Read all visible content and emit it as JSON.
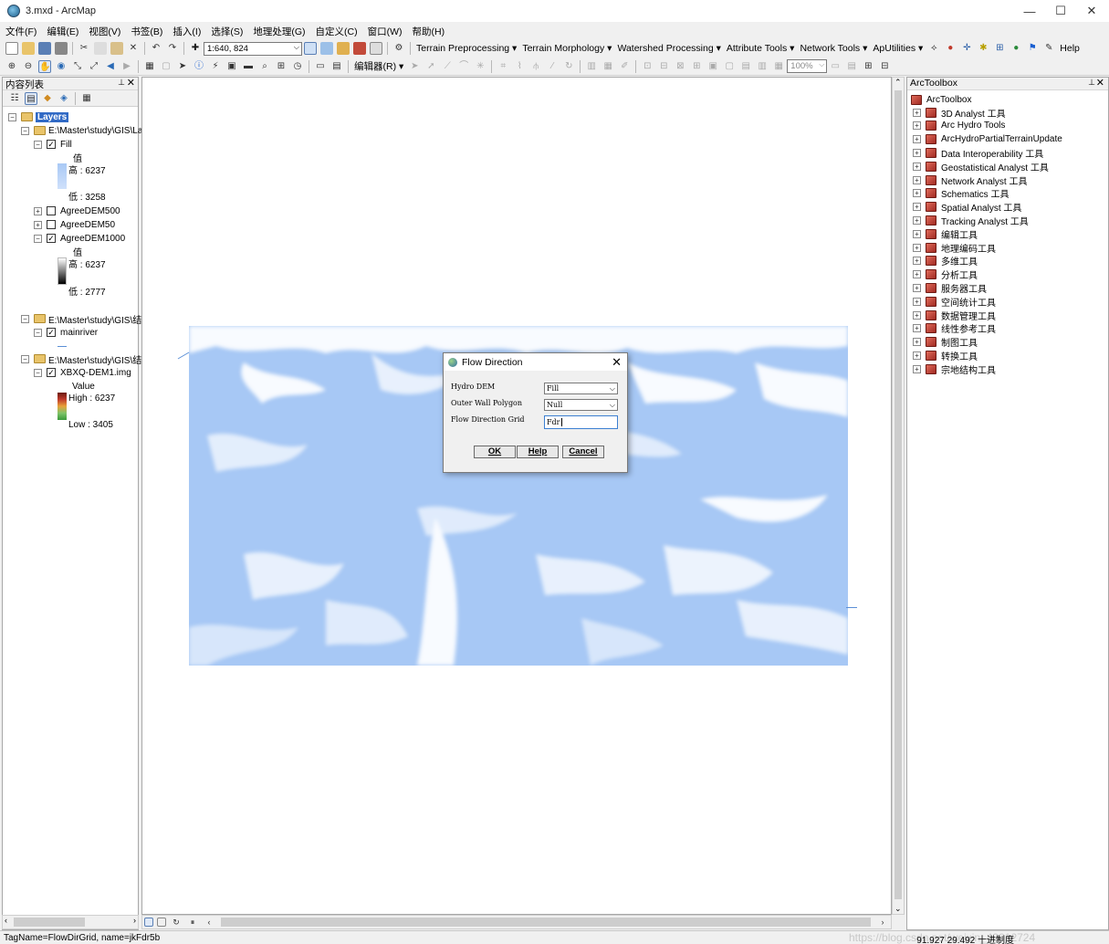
{
  "window": {
    "title": "3.mxd - ArcMap",
    "minimize": "—",
    "maximize": "☐",
    "close": "✕"
  },
  "menu": [
    "文件(F)",
    "编辑(E)",
    "视图(V)",
    "书签(B)",
    "插入(I)",
    "选择(S)",
    "地理处理(G)",
    "自定义(C)",
    "窗口(W)",
    "帮助(H)"
  ],
  "toolbar": {
    "scale": "1:640, 824",
    "menus": [
      "Terrain Preprocessing",
      "Terrain Morphology",
      "Watershed Processing",
      "Attribute Tools",
      "Network Tools",
      "ApUtilities"
    ],
    "help": "Help",
    "editor": "编辑器(R)",
    "zoom": "100%"
  },
  "toc": {
    "title": "内容列表",
    "layers_label": "Layers",
    "groups": [
      {
        "path": "E:\\Master\\study\\GIS\\La"
      },
      {
        "path": "E:\\Master\\study\\GIS\\结"
      },
      {
        "path": "E:\\Master\\study\\GIS\\结"
      }
    ],
    "fill": {
      "name": "Fill",
      "value_hdr": "值",
      "high": "高 : 6237",
      "low": "低 : 3258"
    },
    "agree500": "AgreeDEM500",
    "agree50": "AgreeDEM50",
    "agree1000": {
      "name": "AgreeDEM1000",
      "value_hdr": "值",
      "high": "高 : 6237",
      "low": "低 : 2777"
    },
    "mainriver": "mainriver",
    "xbxq": {
      "name": "XBXQ-DEM1.img",
      "value_hdr": "Value",
      "high": "High : 6237",
      "low": "Low : 3405"
    }
  },
  "arctoolbox": {
    "title": "ArcToolbox",
    "root": "ArcToolbox",
    "items": [
      "3D Analyst 工具",
      "Arc Hydro Tools",
      "ArcHydroPartialTerrainUpdate",
      "Data Interoperability 工具",
      "Geostatistical Analyst 工具",
      "Network Analyst 工具",
      "Schematics 工具",
      "Spatial Analyst 工具",
      "Tracking Analyst 工具",
      "编辑工具",
      "地理编码工具",
      "多维工具",
      "分析工具",
      "服务器工具",
      "空间统计工具",
      "数据管理工具",
      "线性参考工具",
      "制图工具",
      "转换工具",
      "宗地结构工具"
    ]
  },
  "dialog": {
    "title": "Flow Direction",
    "fields": [
      {
        "label": "Hydro DEM",
        "value": "Fill"
      },
      {
        "label": "Outer Wall Polygon",
        "value": "Null"
      },
      {
        "label": "Flow Direction Grid",
        "value": "Fdr"
      }
    ],
    "ok": "OK",
    "help": "Help",
    "cancel": "Cancel"
  },
  "status": {
    "left": "TagName=FlowDirGrid, name=jkFdr5b",
    "coords": "91.927  29.492 十进制度"
  },
  "watermark": "https://blog.csdn.net/weixin_43012724",
  "colors": {
    "dem_base": "#a7c8f5",
    "dem_light": "#ffffff"
  }
}
